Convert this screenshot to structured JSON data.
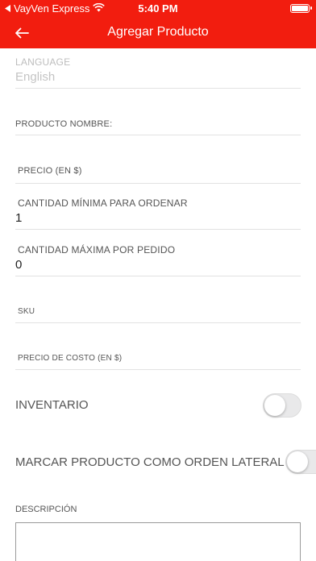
{
  "status_bar": {
    "back_app": "VayVen Express",
    "time": "5:40 PM"
  },
  "header": {
    "title": "Agregar Producto"
  },
  "form": {
    "language": {
      "label": "LANGUAGE",
      "value": "English"
    },
    "product_name": {
      "label": "PRODUCTO NOMBRE:",
      "value": ""
    },
    "price": {
      "label": "PRECIO (EN $)",
      "value": ""
    },
    "min_qty": {
      "label": "CANTIDAD MÍNIMA PARA ORDENAR",
      "value": "1"
    },
    "max_qty": {
      "label": "CANTIDAD MÁXIMA POR PEDIDO",
      "value": "0"
    },
    "sku": {
      "label": "SKU",
      "value": ""
    },
    "cost_price": {
      "label": "PRECIO DE COSTO (EN $)",
      "value": ""
    },
    "inventory": {
      "label": "INVENTARIO",
      "on": false
    },
    "side_order": {
      "label": "MARCAR PRODUCTO COMO ORDEN LATERAL",
      "on": false
    },
    "description": {
      "label": "DESCRIPCIÓN",
      "value": ""
    }
  },
  "colors": {
    "accent": "#f21d0f"
  }
}
